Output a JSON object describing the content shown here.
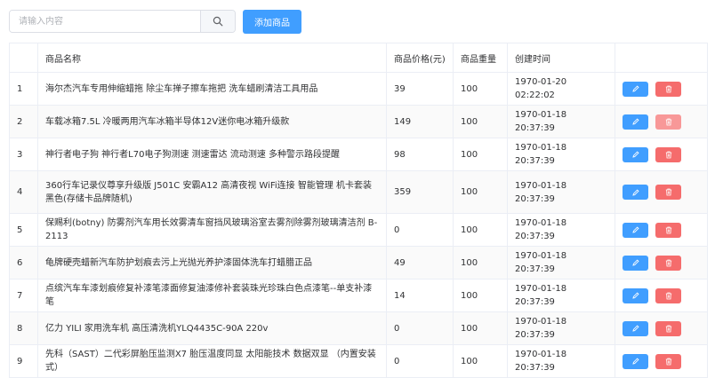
{
  "search": {
    "placeholder": "请输入内容"
  },
  "toolbar": {
    "add_label": "添加商品"
  },
  "table": {
    "headers": [
      "",
      "商品名称",
      "商品价格(元)",
      "商品重量",
      "创建时间",
      ""
    ],
    "rows": [
      {
        "index": "1",
        "name": "海尔杰汽车专用伸缩蜡拖 除尘车掸子擦车拖把 洗车蜡刷清洁工具用品",
        "price": "39",
        "weight": "100",
        "created": "1970-01-20 02:22:02"
      },
      {
        "index": "2",
        "name": "车载冰箱7.5L 冷暖两用汽车冰箱半导体12V迷你电冰箱升级款",
        "price": "149",
        "weight": "100",
        "created": "1970-01-18 20:37:39"
      },
      {
        "index": "3",
        "name": "神行者电子狗 神行者L70电子狗测速 测速雷达 流动测速 多种警示路段提醒",
        "price": "98",
        "weight": "100",
        "created": "1970-01-18 20:37:39"
      },
      {
        "index": "4",
        "name": "360行车记录仪尊享升级版 J501C 安霸A12 高清夜视 WiFi连接 智能管理 机卡套装 黑色(存储卡品牌随机)",
        "price": "359",
        "weight": "100",
        "created": "1970-01-18 20:37:39"
      },
      {
        "index": "5",
        "name": "保赐利(botny) 防雾剂汽车用长效雾清车窗挡风玻璃浴室去雾剂除雾剂玻璃清洁剂 B-2113",
        "price": "0",
        "weight": "100",
        "created": "1970-01-18 20:37:39"
      },
      {
        "index": "6",
        "name": "龟牌硬壳蜡新汽车防护划痕去污上光抛光养护漆固体洗车打蜡腊正品",
        "price": "49",
        "weight": "100",
        "created": "1970-01-18 20:37:39"
      },
      {
        "index": "7",
        "name": "点缤汽车车漆划痕修复补漆笔漆面修复油漆修补套装珠光珍珠白色点漆笔--单支补漆笔",
        "price": "14",
        "weight": "100",
        "created": "1970-01-18 20:37:39"
      },
      {
        "index": "8",
        "name": "亿力 YILI 家用洗车机 高压清洗机YLQ4435C-90A 220v",
        "price": "0",
        "weight": "100",
        "created": "1970-01-18 20:37:39"
      },
      {
        "index": "9",
        "name": "先科（SAST）二代彩屏胎压监测X7 胎压温度同显 太阳能技术 数据双显 （内置安装式）",
        "price": "0",
        "weight": "100",
        "created": "1970-01-18 20:37:39"
      }
    ]
  },
  "icons": {
    "search": "search-icon",
    "edit": "edit-icon",
    "delete": "trash-icon"
  },
  "colors": {
    "primary": "#409eff",
    "danger": "#f56c6c",
    "danger_light": "#f89898",
    "border": "#ebeef5"
  }
}
